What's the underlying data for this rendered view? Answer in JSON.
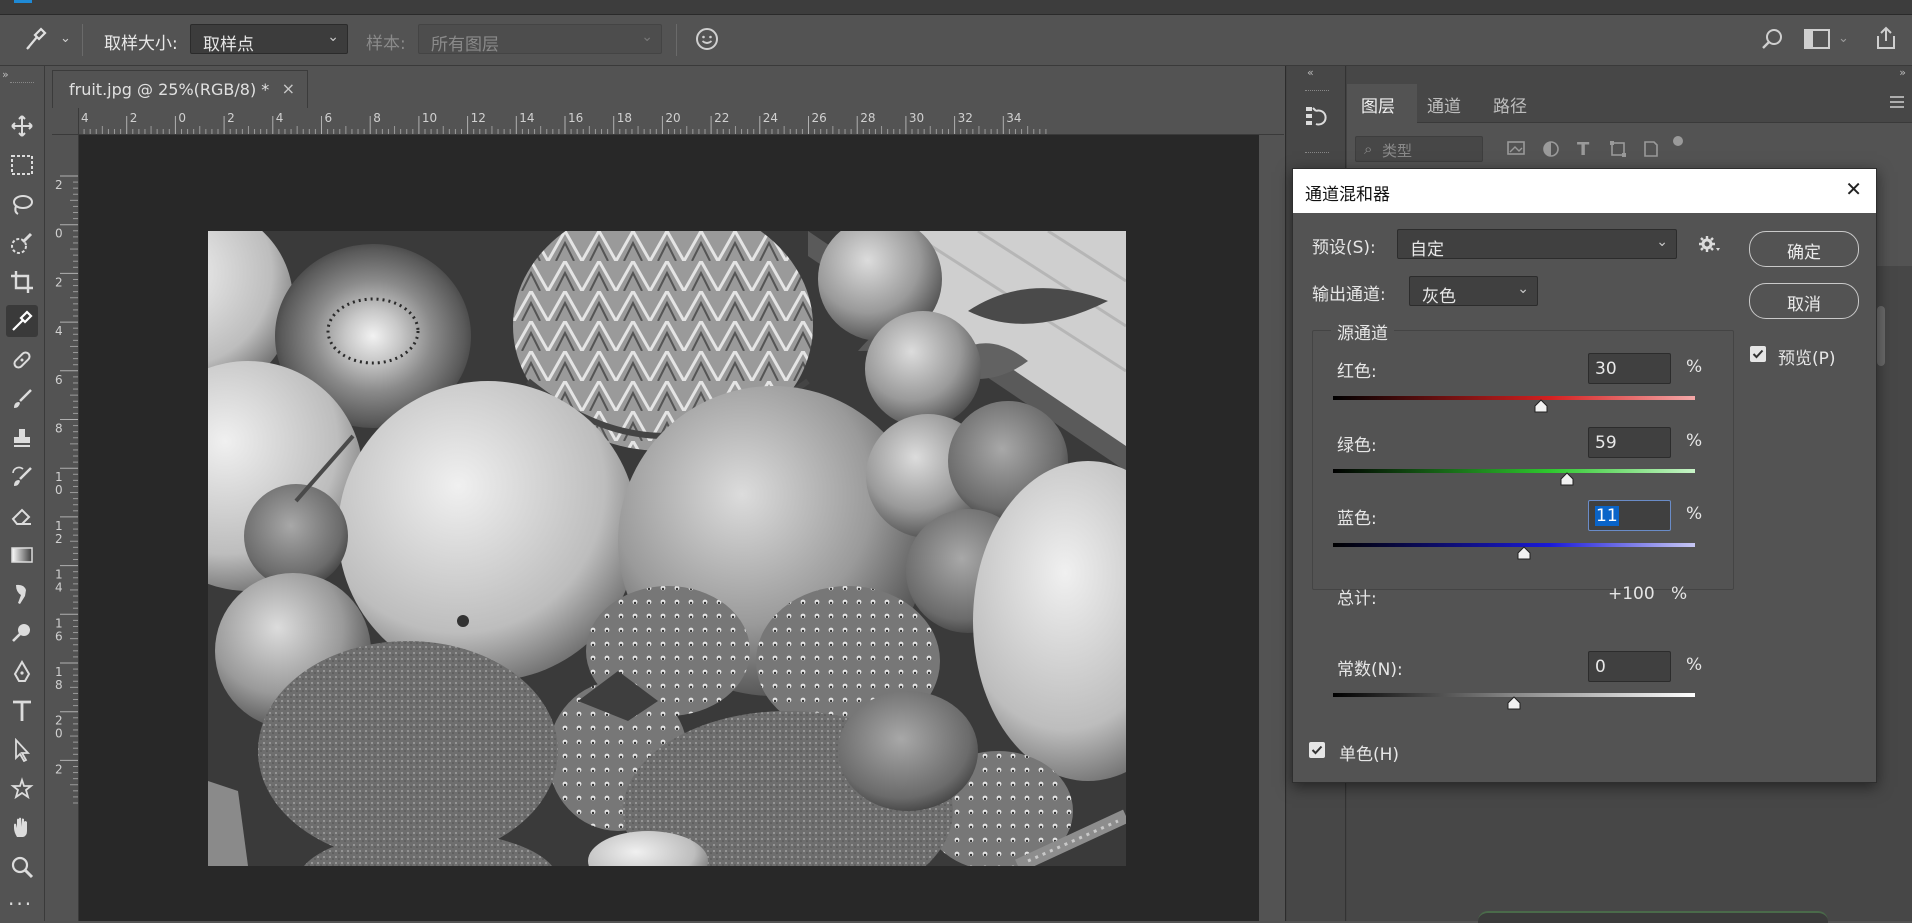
{
  "options_bar": {
    "sample_size_label": "取样大小:",
    "sample_size_value": "取样点",
    "sample_label": "样本:",
    "sample_value": "所有图层"
  },
  "document": {
    "tab_title": "fruit.jpg @ 25%(RGB/8) *",
    "close_glyph": "×",
    "h_ruler_ticks": [
      "4",
      "2",
      "0",
      "2",
      "4",
      "6",
      "8",
      "10",
      "12",
      "14",
      "16",
      "18",
      "20",
      "22",
      "24",
      "26",
      "28",
      "30",
      "32",
      "34"
    ],
    "v_ruler_ticks": [
      "2",
      "0",
      "2",
      "4",
      "6",
      "8",
      "10",
      "12",
      "14",
      "16",
      "18",
      "20",
      "2"
    ]
  },
  "layers_panel": {
    "tabs": [
      "图层",
      "通道",
      "路径"
    ],
    "filter_placeholder": "类型"
  },
  "dialog": {
    "title": "通道混和器",
    "close_glyph": "✕",
    "preset_label": "预设(S):",
    "preset_value": "自定",
    "output_label": "输出通道:",
    "output_value": "灰色",
    "source_group": "源通道",
    "red_label": "红色:",
    "red_value": "30",
    "red_level": 30,
    "green_label": "绿色:",
    "green_value": "59",
    "green_level": 59,
    "blue_label": "蓝色:",
    "blue_value": "11",
    "blue_level": 11,
    "total_label": "总计:",
    "total_value": "+100",
    "constant_label": "常数(N):",
    "constant_value": "0",
    "constant_level": 0,
    "percent": "%",
    "monochrome_label": "单色(H)",
    "monochrome_checked": true,
    "ok_label": "确定",
    "cancel_label": "取消",
    "preview_label": "预览(P)",
    "preview_checked": true
  },
  "colors": {
    "accent": "#0a64c8",
    "red": "#d42020",
    "green": "#2ec82e",
    "blue": "#1a1ad8"
  }
}
